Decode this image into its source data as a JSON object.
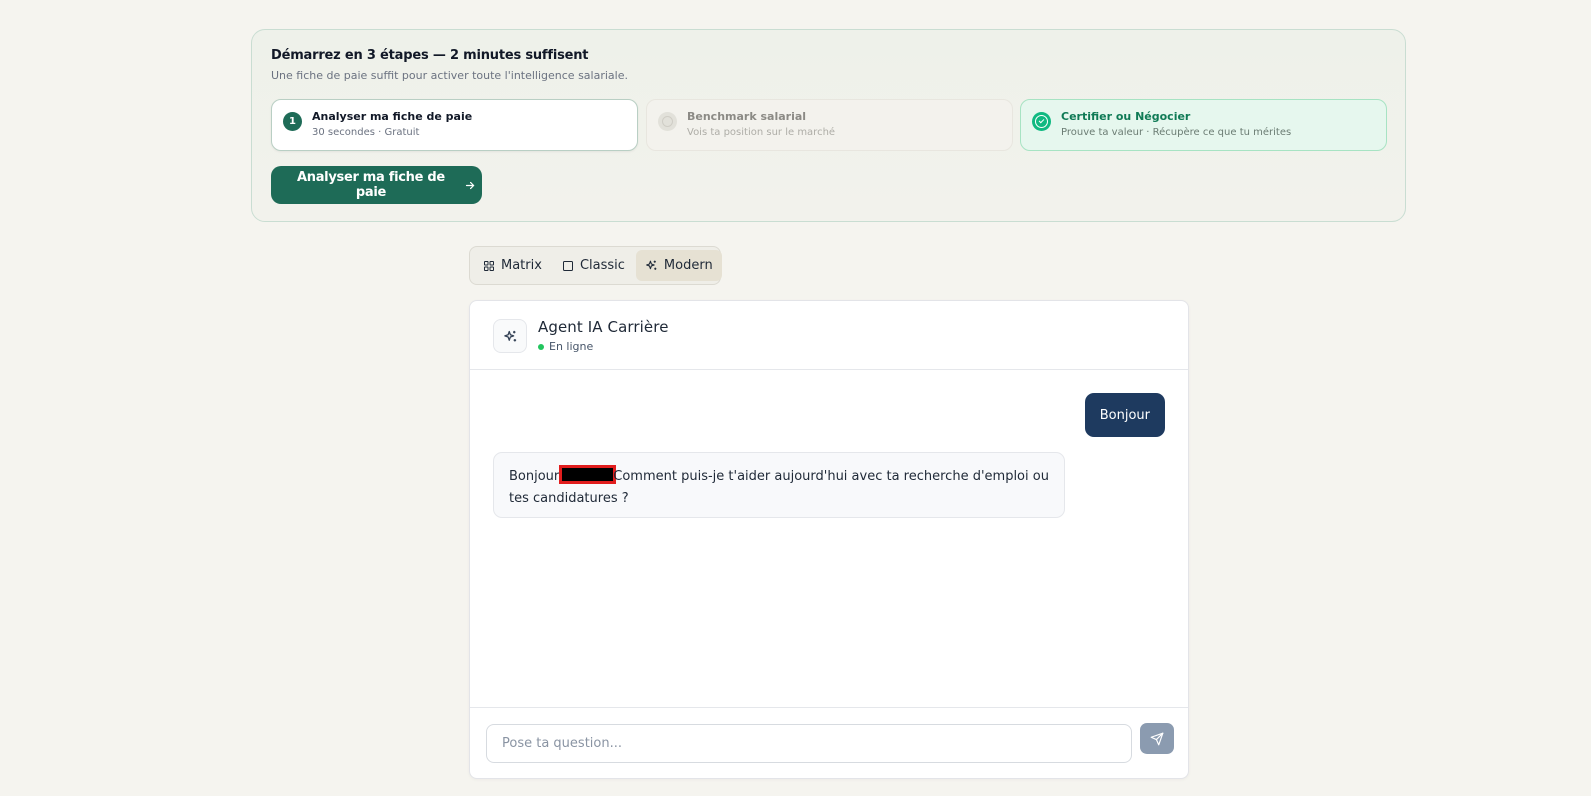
{
  "onboarding": {
    "title": "Démarrez en 3 étapes — 2 minutes suffisent",
    "subtitle": "Une fiche de paie suffit pour activer toute l'intelligence salariale.",
    "steps": [
      {
        "number": "1",
        "title": "Analyser ma fiche de paie",
        "description": "30 secondes · Gratuit",
        "state": "active"
      },
      {
        "number": "",
        "title": "Benchmark salarial",
        "description": "Vois ta position sur le marché",
        "state": "pending"
      },
      {
        "number": "",
        "title": "Certifier ou Négocier",
        "description": "Prouve ta valeur · Récupère ce que tu mérites",
        "state": "done"
      }
    ],
    "cta_label": "Analyser ma fiche de paie",
    "accent_color": "#1e6b57"
  },
  "view_switcher": {
    "options": [
      {
        "label": "Matrix",
        "icon": "grid-icon",
        "active": false
      },
      {
        "label": "Classic",
        "icon": "square-icon",
        "active": false
      },
      {
        "label": "Modern",
        "icon": "sparkles-icon",
        "active": true
      }
    ]
  },
  "chat": {
    "agent_name": "Agent IA Carrière",
    "status": "En ligne",
    "status_color": "#22c55e",
    "messages": [
      {
        "role": "user",
        "text": "Bonjour"
      },
      {
        "role": "agent",
        "text_before": "Bonjour",
        "text_after": "Comment puis-je t'aider aujourd'hui avec ta recherche d'emploi ou tes candidatures ?"
      }
    ],
    "input_placeholder": "Pose ta question...",
    "user_bubble_color": "#1e3a5f"
  }
}
